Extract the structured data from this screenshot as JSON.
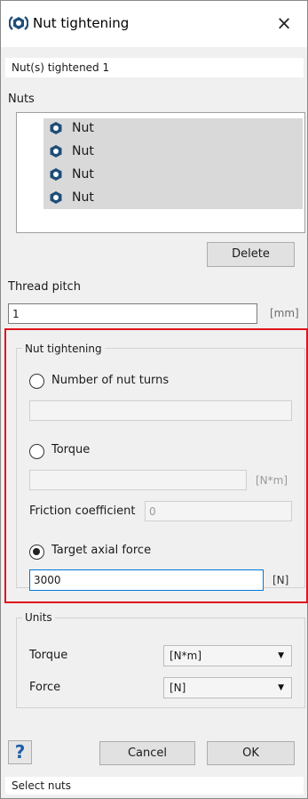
{
  "window": {
    "title": "Nut tightening",
    "close_glyph": "×",
    "title_icon": "nut-tightening-app-icon"
  },
  "status_top": "Nut(s) tightened 1",
  "nuts": {
    "label": "Nuts",
    "items": [
      {
        "label": "Nut",
        "icon": "hex-nut-icon"
      },
      {
        "label": "Nut",
        "icon": "hex-nut-icon"
      },
      {
        "label": "Nut",
        "icon": "hex-nut-icon"
      },
      {
        "label": "Nut",
        "icon": "hex-nut-icon"
      }
    ],
    "delete_label": "Delete"
  },
  "thread_pitch": {
    "label": "Thread pitch",
    "value": "1",
    "unit": "[mm]"
  },
  "nut_tightening": {
    "legend": "Nut tightening",
    "options": {
      "turns": {
        "label": "Number of nut turns",
        "value": "",
        "selected": false
      },
      "torque": {
        "label": "Torque",
        "value": "",
        "unit": "[N*m]",
        "selected": false
      },
      "friction": {
        "label": "Friction coefficient",
        "value": "0"
      },
      "axial": {
        "label": "Target axial force",
        "value": "3000",
        "unit": "[N]",
        "selected": true
      }
    }
  },
  "units": {
    "legend": "Units",
    "torque": {
      "label": "Torque",
      "value": "[N*m]"
    },
    "force": {
      "label": "Force",
      "value": "[N]"
    }
  },
  "footer": {
    "help_label": "?",
    "cancel_label": "Cancel",
    "ok_label": "OK"
  },
  "status_bottom": "Select nuts",
  "colors": {
    "highlight": "#e0141e",
    "nut_icon": "#1f4e79",
    "focus_border": "#0078d7"
  }
}
